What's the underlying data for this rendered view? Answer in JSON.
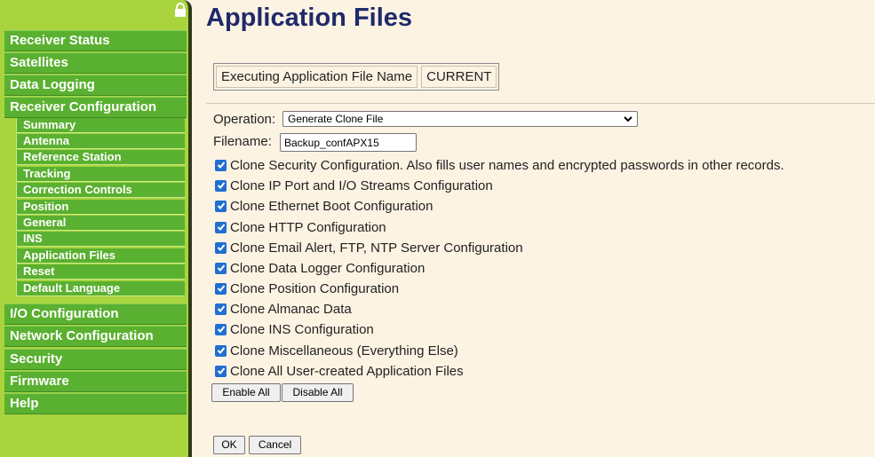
{
  "page": {
    "title": "Application Files"
  },
  "sidebar": {
    "items": [
      {
        "label": "Receiver Status"
      },
      {
        "label": "Satellites"
      },
      {
        "label": "Data Logging"
      },
      {
        "label": "Receiver Configuration"
      },
      {
        "label": "I/O Configuration"
      },
      {
        "label": "Network Configuration"
      },
      {
        "label": "Security"
      },
      {
        "label": "Firmware"
      },
      {
        "label": "Help"
      }
    ],
    "subitems": [
      {
        "label": "Summary"
      },
      {
        "label": "Antenna"
      },
      {
        "label": "Reference Station"
      },
      {
        "label": "Tracking"
      },
      {
        "label": "Correction Controls"
      },
      {
        "label": "Position"
      },
      {
        "label": "General"
      },
      {
        "label": "INS"
      },
      {
        "label": "Application Files"
      },
      {
        "label": "Reset"
      },
      {
        "label": "Default Language"
      }
    ]
  },
  "executing": {
    "label": "Executing Application File Name",
    "value": "CURRENT"
  },
  "form": {
    "operation_label": "Operation:",
    "operation_value": "Generate Clone File",
    "filename_label": "Filename:",
    "filename_value": "Backup_confAPX15"
  },
  "options": [
    {
      "label": "Clone Security Configuration. Also fills user names and encrypted passwords in other records.",
      "checked": true
    },
    {
      "label": "Clone IP Port and I/O Streams Configuration",
      "checked": true
    },
    {
      "label": "Clone Ethernet Boot Configuration",
      "checked": true
    },
    {
      "label": "Clone HTTP Configuration",
      "checked": true
    },
    {
      "label": "Clone Email Alert, FTP, NTP Server Configuration",
      "checked": true
    },
    {
      "label": "Clone Data Logger Configuration",
      "checked": true
    },
    {
      "label": "Clone Position Configuration",
      "checked": true
    },
    {
      "label": "Clone Almanac Data",
      "checked": true
    },
    {
      "label": "Clone INS Configuration",
      "checked": true
    },
    {
      "label": "Clone Miscellaneous (Everything Else)",
      "checked": true
    },
    {
      "label": "Clone All User-created Application Files",
      "checked": true
    }
  ],
  "buttons": {
    "enable_all": "Enable All",
    "disable_all": "Disable All",
    "ok": "OK",
    "cancel": "Cancel"
  },
  "colors": {
    "nav_green": "#5ab030",
    "sidebar_bg": "#a9d43e",
    "title_blue": "#1e2a6a",
    "checkbox_blue": "#1f6fd1",
    "page_bg": "#fdf3e3"
  },
  "icons": {
    "lock": "lock-icon",
    "dropdown": "chevron-down-icon",
    "check": "checkmark-icon"
  }
}
